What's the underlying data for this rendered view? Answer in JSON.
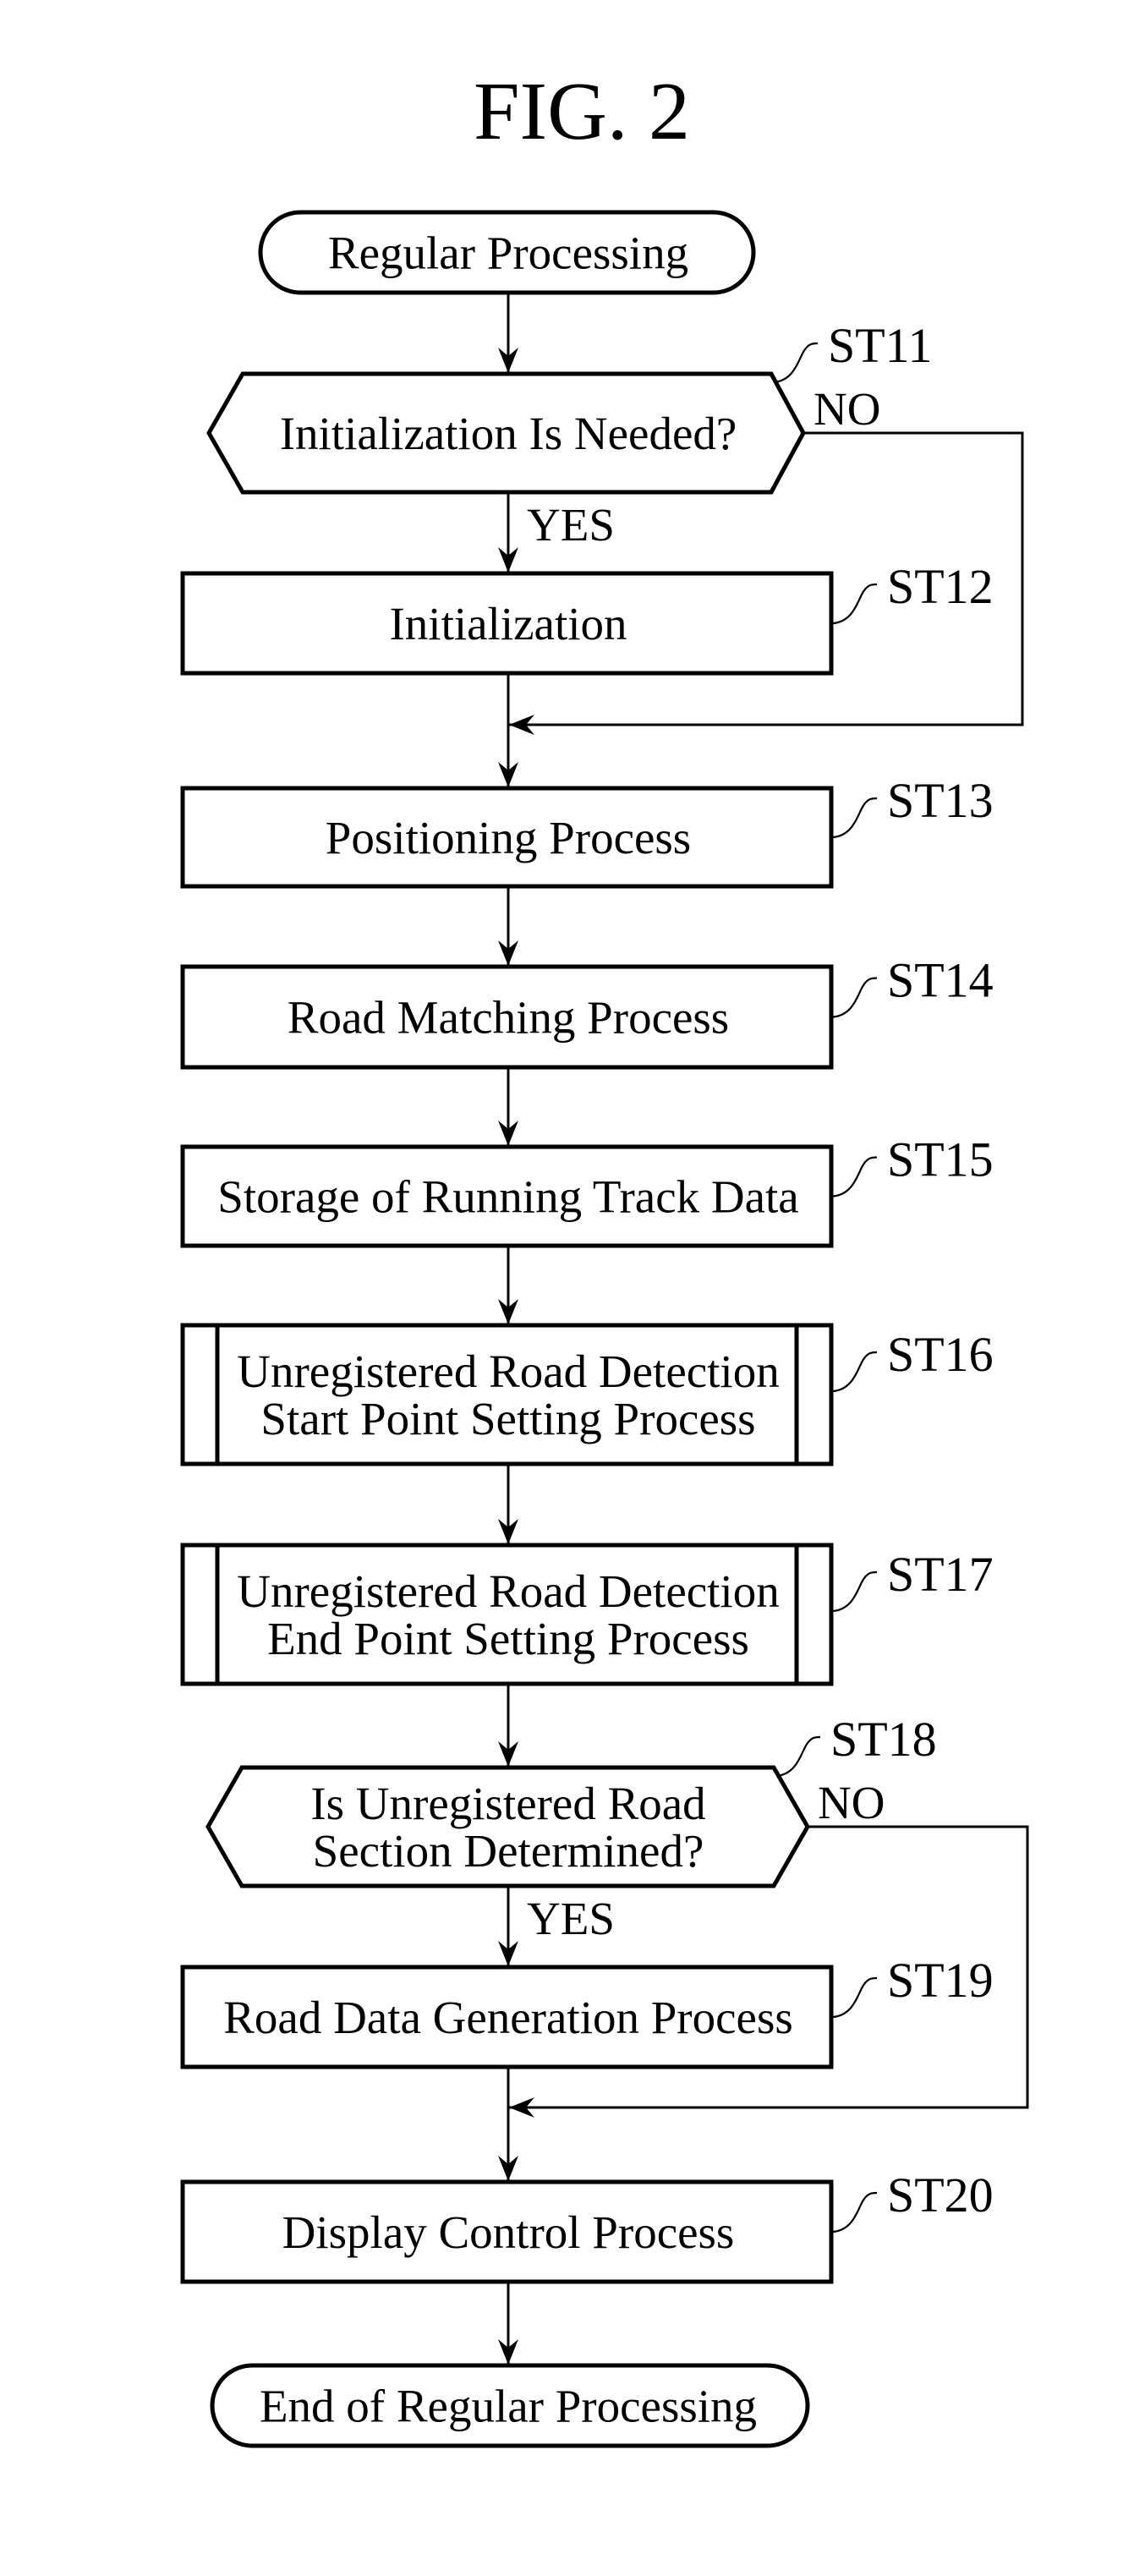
{
  "figure": {
    "title": "FIG. 2"
  },
  "flowchart": {
    "start": {
      "type": "terminal",
      "label": "Regular Processing"
    },
    "steps": [
      {
        "id": "ST11",
        "type": "decision",
        "lines": [
          "Initialization Is Needed?"
        ],
        "yes_label": "YES",
        "no_label": "NO"
      },
      {
        "id": "ST12",
        "type": "process",
        "lines": [
          "Initialization"
        ]
      },
      {
        "id": "ST13",
        "type": "process",
        "lines": [
          "Positioning Process"
        ]
      },
      {
        "id": "ST14",
        "type": "process",
        "lines": [
          "Road Matching Process"
        ]
      },
      {
        "id": "ST15",
        "type": "process",
        "lines": [
          "Storage of Running Track Data"
        ]
      },
      {
        "id": "ST16",
        "type": "predefined",
        "lines": [
          "Unregistered Road Detection",
          "Start Point Setting Process"
        ]
      },
      {
        "id": "ST17",
        "type": "predefined",
        "lines": [
          "Unregistered Road Detection",
          "End Point Setting Process"
        ]
      },
      {
        "id": "ST18",
        "type": "decision",
        "lines": [
          "Is Unregistered Road",
          "Section Determined?"
        ],
        "yes_label": "YES",
        "no_label": "NO"
      },
      {
        "id": "ST19",
        "type": "process",
        "lines": [
          "Road Data Generation Process"
        ]
      },
      {
        "id": "ST20",
        "type": "process",
        "lines": [
          "Display Control Process"
        ]
      }
    ],
    "end": {
      "type": "terminal",
      "label": "End of Regular Processing"
    },
    "edges": [
      {
        "from": "start",
        "to": "ST11"
      },
      {
        "from": "ST11",
        "to": "ST12",
        "label": "YES"
      },
      {
        "from": "ST11",
        "to": "ST13",
        "label": "NO",
        "route": "bypass-right"
      },
      {
        "from": "ST12",
        "to": "ST13"
      },
      {
        "from": "ST13",
        "to": "ST14"
      },
      {
        "from": "ST14",
        "to": "ST15"
      },
      {
        "from": "ST15",
        "to": "ST16"
      },
      {
        "from": "ST16",
        "to": "ST17"
      },
      {
        "from": "ST17",
        "to": "ST18"
      },
      {
        "from": "ST18",
        "to": "ST19",
        "label": "YES"
      },
      {
        "from": "ST18",
        "to": "ST20",
        "label": "NO",
        "route": "bypass-right"
      },
      {
        "from": "ST19",
        "to": "ST20"
      },
      {
        "from": "ST20",
        "to": "end"
      }
    ]
  }
}
